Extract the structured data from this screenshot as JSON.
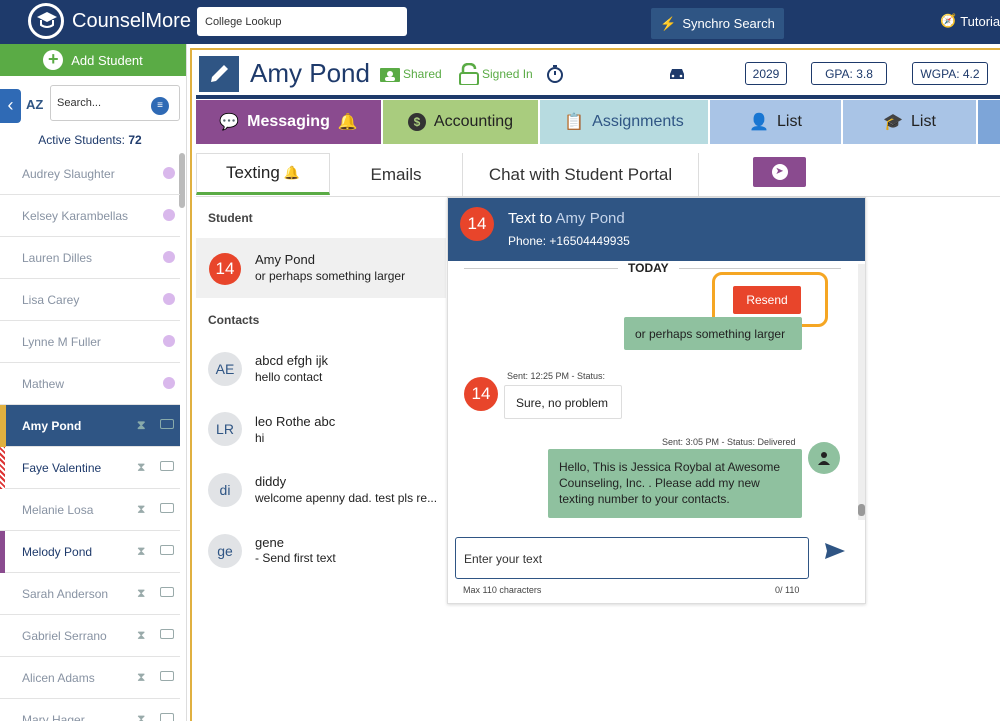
{
  "app": {
    "brand": "CounselMore"
  },
  "topbar": {
    "college_input_value": "College Lookup",
    "synchro_label": "Synchro Search",
    "tutorial_label": "Tutorial"
  },
  "sidebar": {
    "add_student_label": "Add Student",
    "az_label": "AZ",
    "search_placeholder": "Search...",
    "active_label": "Active Students:",
    "active_count": "72",
    "students": [
      {
        "name": "Audrey Slaughter"
      },
      {
        "name": "Kelsey Karambellas"
      },
      {
        "name": "Lauren Dilles"
      },
      {
        "name": "Lisa Carey"
      },
      {
        "name": "Lynne M Fuller"
      },
      {
        "name": "Mathew"
      },
      {
        "name": "Amy Pond"
      },
      {
        "name": "Faye Valentine"
      },
      {
        "name": "Melanie Losa"
      },
      {
        "name": "Melody Pond"
      },
      {
        "name": "Sarah Anderson"
      },
      {
        "name": "Gabriel Serrano"
      },
      {
        "name": "Alicen Adams"
      },
      {
        "name": "Mary Hager"
      }
    ]
  },
  "student_header": {
    "name": "Amy Pond",
    "shared_label": "Shared",
    "signed_in_label": "Signed In",
    "year": "2029",
    "gpa": "GPA: 3.8",
    "wgpa": "WGPA: 4.2"
  },
  "tabs": [
    {
      "label": "Messaging"
    },
    {
      "label": "Accounting"
    },
    {
      "label": "Assignments"
    },
    {
      "label": "List"
    },
    {
      "label": "List"
    }
  ],
  "sub_tabs": [
    {
      "label": "Texting"
    },
    {
      "label": "Emails"
    },
    {
      "label": "Chat with Student Portal"
    }
  ],
  "texting": {
    "student_label": "Student",
    "student": {
      "badge": "14",
      "name": "Amy Pond",
      "preview": "or perhaps something larger"
    },
    "contacts_label": "Contacts",
    "contacts": [
      {
        "initials": "AE",
        "name": "abcd efgh ijk",
        "preview": "hello contact"
      },
      {
        "initials": "LR",
        "name": "leo Rothe abc",
        "preview": "hi"
      },
      {
        "initials": "di",
        "name": "diddy",
        "preview": "welcome apenny dad. test pls re..."
      },
      {
        "initials": "ge",
        "name": "gene",
        "preview": "- Send first text"
      }
    ]
  },
  "chat": {
    "badge": "14",
    "title_prefix": "Text to",
    "title_name": "Amy Pond",
    "phone": "Phone: +16504449935",
    "today_label": "TODAY",
    "resend_label": "Resend",
    "msg1": "or perhaps something larger",
    "msg2_meta": "Sent: 12:25 PM - Status:",
    "msg2_badge": "14",
    "msg2": "Sure, no problem",
    "msg3_meta": "Sent: 3:05 PM - Status: Delivered",
    "msg3": "Hello, This is Jessica Roybal at Awesome Counseling, Inc. . Please add my new texting number to your contacts.",
    "input_placeholder": "Enter your text",
    "max_chars": "Max 110 characters",
    "char_count": "0/ 110"
  },
  "colors": {
    "navy": "#1e3a6b",
    "accent_blue": "#2f5584",
    "green": "#5aab45",
    "red": "#e8452b",
    "orange_highlight": "#f5a623"
  }
}
